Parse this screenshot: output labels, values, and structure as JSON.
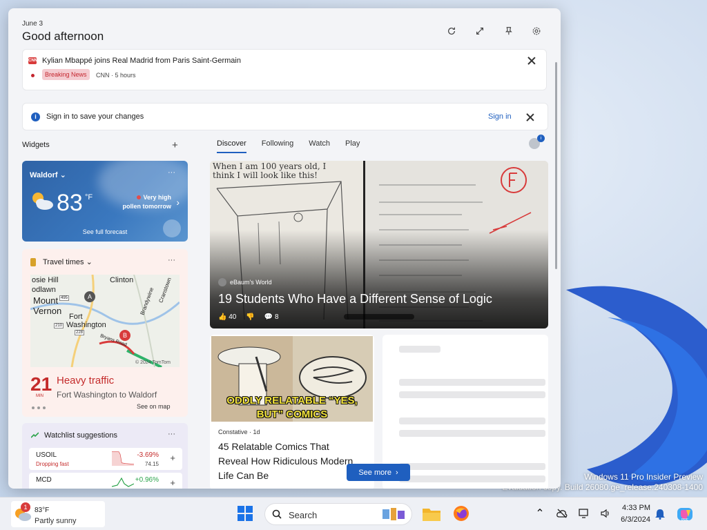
{
  "panel": {
    "date": "June 3",
    "greeting": "Good afternoon"
  },
  "breaking": {
    "headline": "Kylian Mbappé joins Real Madrid from Paris Saint-Germain",
    "badge": "Breaking News",
    "source": "CNN · 5 hours"
  },
  "signin": {
    "message": "Sign in to save your changes",
    "link": "Sign in"
  },
  "widgets_label": "Widgets",
  "tabs": [
    "Discover",
    "Following",
    "Watch",
    "Play"
  ],
  "weather": {
    "location": "Waldorf",
    "temp": "83",
    "unit": "°F",
    "pollen_line1": "Very high",
    "pollen_line2": "pollen tomorrow",
    "forecast_link": "See full forecast"
  },
  "traffic": {
    "title": "Travel times",
    "minutes": "21",
    "minutes_label": "MIN",
    "status": "Heavy traffic",
    "route": "Fort Washington to Waldorf",
    "map_link": "See on map",
    "map_labels": [
      "osie Hill",
      "odlawn",
      "Mount",
      "Vernon",
      "Fort",
      "Washington",
      "Clinton",
      "Brandywine",
      "Cranstown",
      "Bryans Road",
      "© 2024 TomTom"
    ],
    "map_markers": [
      "A",
      "B"
    ],
    "road_shields": [
      "495",
      "210",
      "228"
    ]
  },
  "watchlist": {
    "title": "Watchlist suggestions",
    "stocks": [
      {
        "symbol": "USOIL",
        "sub": "Dropping fast",
        "change": "-3.69%",
        "price": "74.15"
      },
      {
        "symbol": "MCD",
        "sub": "",
        "change": "+0.96%",
        "price": ""
      }
    ]
  },
  "hero": {
    "handwriting_line1": "When I am 100 years old, I",
    "handwriting_line2": "think I will look like this!",
    "source": "eBaum's World",
    "title": "19 Students Who Have a Different Sense of Logic",
    "likes": "40",
    "comments": "8"
  },
  "comic": {
    "caption_line1": "ODDLY RELATABLE “YES,",
    "caption_line2": "BUT” COMICS",
    "source": "Constative · 1d",
    "title": "45 Relatable Comics That Reveal How Ridiculous Modern Life Can Be"
  },
  "see_more": "See more",
  "watermark": {
    "line1": "Windows 11 Pro Insider Preview",
    "line2": "Evaluation copy. Build 26080.ge_release.240308-1400"
  },
  "taskbar": {
    "weather_badge": "1",
    "weather_temp": "83°F",
    "weather_condition": "Partly sunny",
    "search_placeholder": "Search",
    "time": "4:33 PM",
    "date": "6/3/2024"
  },
  "colors": {
    "accent": "#1f5fbf",
    "breaking_red": "#c4262e",
    "traffic_red": "#c42b2b"
  }
}
